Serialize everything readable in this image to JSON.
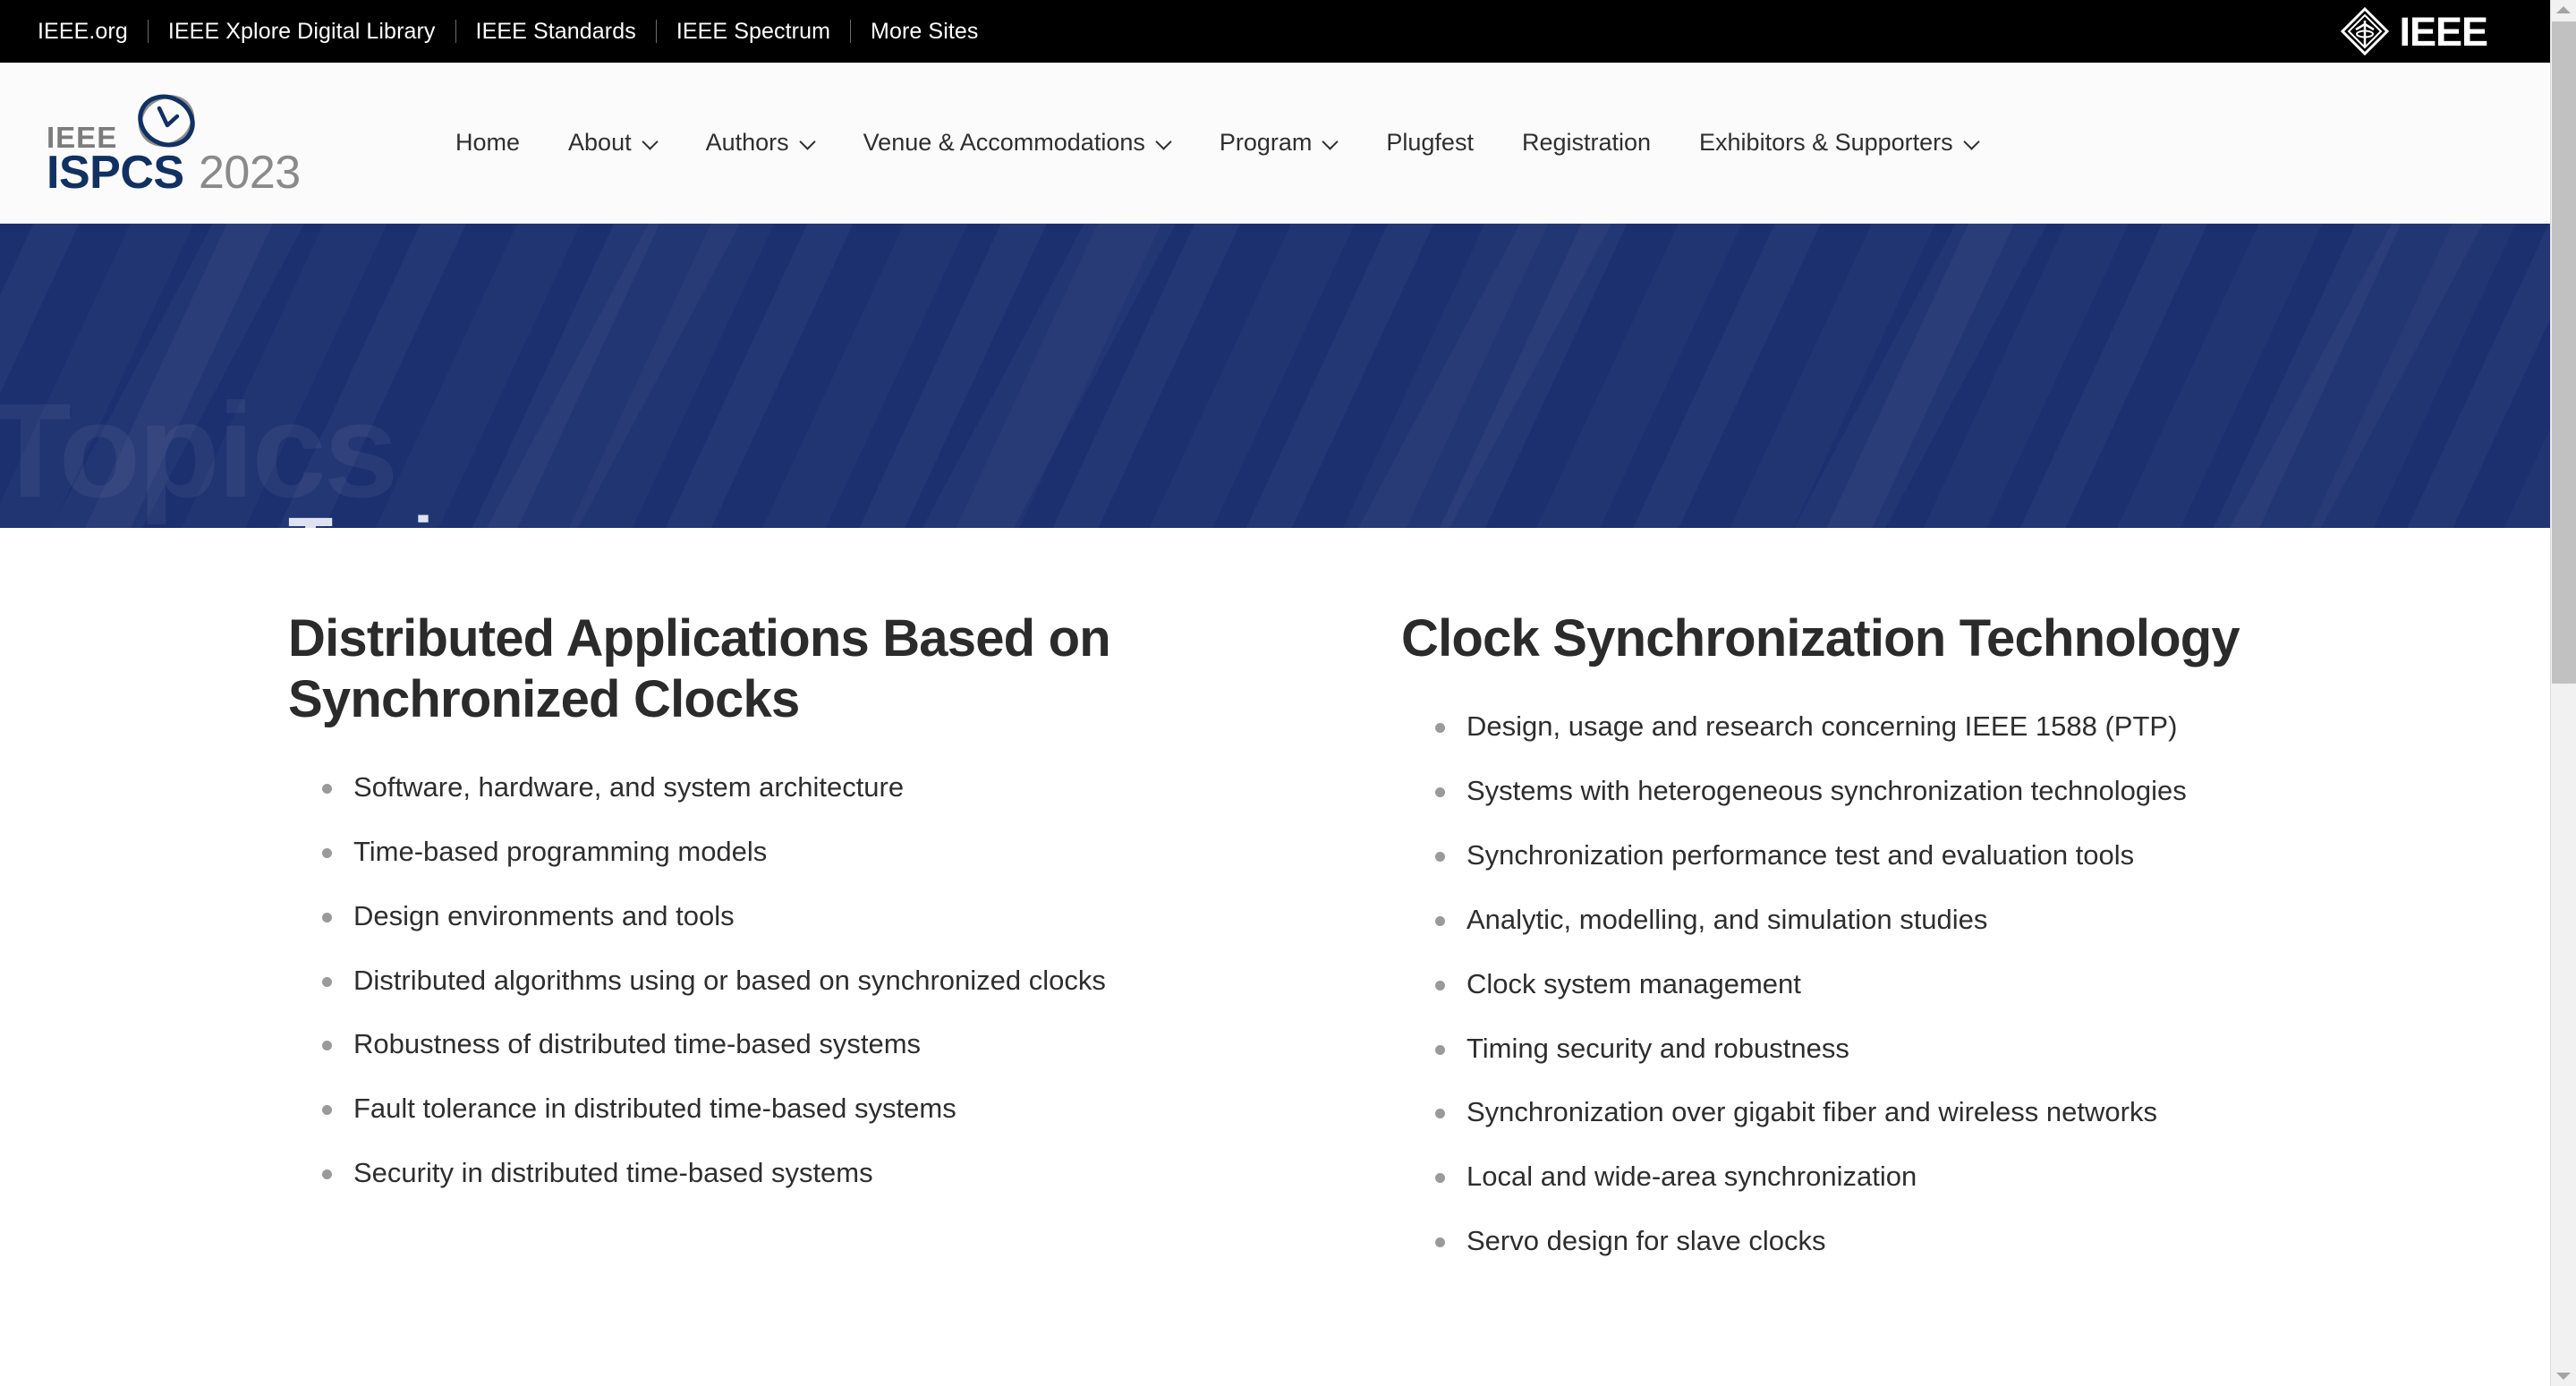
{
  "ieee_bar": {
    "links": [
      {
        "label": "IEEE.org"
      },
      {
        "label": "IEEE Xplore Digital Library"
      },
      {
        "label": "IEEE Standards"
      },
      {
        "label": "IEEE Spectrum"
      },
      {
        "label": "More Sites"
      }
    ],
    "logo_text": "IEEE",
    "logo_icon": "ieee-diamond-icon",
    "background_color": "#000000"
  },
  "header": {
    "brand": {
      "ieee_text": "IEEE",
      "name_text": "ISPCS",
      "year_text": "2023",
      "icon": "clock-orbit-icon",
      "name_color": "#113163",
      "year_color": "#8a8a8a"
    },
    "nav": [
      {
        "label": "Home",
        "has_dropdown": false
      },
      {
        "label": "About",
        "has_dropdown": true
      },
      {
        "label": "Authors",
        "has_dropdown": true
      },
      {
        "label": "Venue & Accommodations",
        "has_dropdown": true
      },
      {
        "label": "Program",
        "has_dropdown": true
      },
      {
        "label": "Plugfest",
        "has_dropdown": false
      },
      {
        "label": "Registration",
        "has_dropdown": false
      },
      {
        "label": "Exhibitors & Supporters",
        "has_dropdown": true
      }
    ]
  },
  "hero": {
    "title": "Topics",
    "watermark": "Topics",
    "background_color": "#1c3070",
    "title_color": "#dfe3ef"
  },
  "content": {
    "columns": [
      {
        "title": "Distributed Applications Based on Synchronized Clocks",
        "items": [
          "Software, hardware, and system architecture",
          "Time-based programming models",
          "Design environments and tools",
          "Distributed algorithms using or based on synchronized clocks",
          "Robustness of distributed time-based systems",
          "Fault tolerance in distributed time-based systems",
          "Security in distributed time-based systems"
        ]
      },
      {
        "title": "Clock Synchronization Technology",
        "items": [
          "Design, usage and research concerning IEEE 1588 (PTP)",
          "Systems with heterogeneous synchronization technologies",
          "Synchronization performance test and evaluation tools",
          "Analytic, modelling, and simulation studies",
          "Clock system management",
          "Timing security and robustness",
          "Synchronization over gigabit fiber and wireless networks",
          "Local and wide-area synchronization",
          "Servo design for slave clocks"
        ]
      }
    ]
  },
  "scrollbar": {
    "up_arrow": "chevron-up-icon",
    "down_arrow": "chevron-down-icon",
    "thumb_color": "#c1c1c1",
    "track_color": "#f1f1f1"
  }
}
